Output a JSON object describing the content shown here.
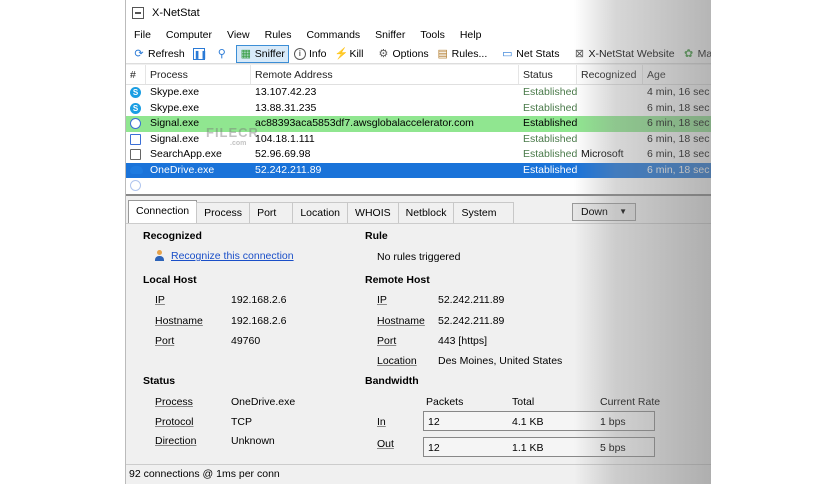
{
  "app": {
    "title": "X-NetStat"
  },
  "menu": [
    "File",
    "Computer",
    "View",
    "Rules",
    "Commands",
    "Sniffer",
    "Tools",
    "Help"
  ],
  "toolbar": {
    "refresh": "Refresh",
    "sniffer": "Sniffer",
    "info": "Info",
    "kill": "Kill",
    "options": "Options",
    "rules": "Rules...",
    "netstats": "Net Stats",
    "website": "X-NetStat Website",
    "mantis": "Mantis Bug Trac"
  },
  "watermark": {
    "text": "FILECR",
    "sub": ".com"
  },
  "list": {
    "columns": [
      "#",
      "Process",
      "Remote Address",
      "Status",
      "Recognized",
      "Age"
    ],
    "rows": [
      {
        "icon": "skype-icon",
        "process": "Skype.exe",
        "address": "13.107.42.23",
        "status": "Established",
        "recognized": "",
        "age": "4 min, 16 sec"
      },
      {
        "icon": "skype-icon",
        "process": "Skype.exe",
        "address": "13.88.31.235",
        "status": "Established",
        "recognized": "",
        "age": "6 min, 18 sec"
      },
      {
        "icon": "signal-icon",
        "process": "Signal.exe",
        "address": "ac88393aca5853df7.awsglobalaccelerator.com",
        "status": "Established",
        "recognized": "",
        "age": "6 min, 18 sec"
      },
      {
        "icon": "signal-icon",
        "process": "Signal.exe",
        "address": "104.18.1.111",
        "status": "Established",
        "recognized": "",
        "age": "6 min, 18 sec"
      },
      {
        "icon": "searchapp-icon",
        "process": "SearchApp.exe",
        "address": "52.96.69.98",
        "status": "Established",
        "recognized": "Microsoft",
        "age": "6 min, 18 sec"
      },
      {
        "icon": "onedrive-icon",
        "process": "OneDrive.exe",
        "address": "52.242.211.89",
        "status": "Established",
        "recognized": "",
        "age": "6 min, 18 sec"
      }
    ]
  },
  "tabs": [
    "Connection",
    "Process",
    "Port",
    "Location",
    "WHOIS",
    "Netblock",
    "System"
  ],
  "down_button": "Down",
  "details": {
    "recognized": {
      "title": "Recognized",
      "link": "Recognize this connection"
    },
    "rule": {
      "title": "Rule",
      "value": "No rules triggered"
    },
    "local": {
      "title": "Local Host",
      "ip_label": "IP",
      "ip": "192.168.2.6",
      "hostname_label": "Hostname",
      "hostname": "192.168.2.6",
      "port_label": "Port",
      "port": "49760"
    },
    "remote": {
      "title": "Remote Host",
      "ip_label": "IP",
      "ip": "52.242.211.89",
      "hostname_label": "Hostname",
      "hostname": "52.242.211.89",
      "port_label": "Port",
      "port": "443 [https]",
      "location_label": "Location",
      "location": "Des Moines, United States"
    },
    "status": {
      "title": "Status",
      "process_label": "Process",
      "process": "OneDrive.exe",
      "protocol_label": "Protocol",
      "protocol": "TCP",
      "direction_label": "Direction",
      "direction": "Unknown"
    },
    "bandwidth": {
      "title": "Bandwidth",
      "headers": [
        "Packets",
        "Total",
        "Current Rate"
      ],
      "in_label": "In",
      "in": {
        "packets": "12",
        "total": "4.1 KB",
        "rate": "1 bps"
      },
      "out_label": "Out",
      "out": {
        "packets": "12",
        "total": "1.1 KB",
        "rate": "5 bps"
      }
    }
  },
  "statusbar": "92 connections @ 1ms per conn"
}
